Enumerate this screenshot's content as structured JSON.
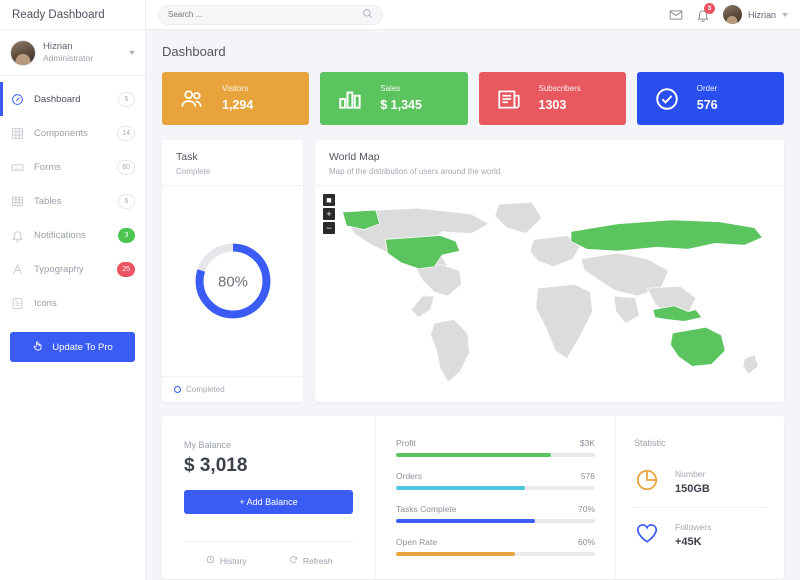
{
  "brand": {
    "title": "Ready Dashboard"
  },
  "user": {
    "name": "Hizrian",
    "role": "Administrator"
  },
  "sidebar": {
    "items": [
      {
        "label": "Dashboard",
        "badge": "5",
        "badge_style": "outline",
        "icon": "gauge-icon",
        "active": true
      },
      {
        "label": "Components",
        "badge": "14",
        "badge_style": "outline",
        "icon": "grid-icon",
        "active": false
      },
      {
        "label": "Forms",
        "badge": "60",
        "badge_style": "outline",
        "icon": "keyboard-icon",
        "active": false
      },
      {
        "label": "Tables",
        "badge": "6",
        "badge_style": "outline",
        "icon": "table-icon",
        "active": false
      },
      {
        "label": "Notifications",
        "badge": "3",
        "badge_style": "green",
        "icon": "bell-icon",
        "active": false
      },
      {
        "label": "Typography",
        "badge": "25",
        "badge_style": "red",
        "icon": "typography-icon",
        "active": false
      },
      {
        "label": "Icons",
        "badge": "",
        "badge_style": "none",
        "icon": "icons-icon",
        "active": false
      }
    ],
    "pro_button": "Update To Pro"
  },
  "topbar": {
    "search_placeholder": "Search ...",
    "search_value": "",
    "notification_count": "3",
    "user_name": "Hizrian"
  },
  "page": {
    "title": "Dashboard"
  },
  "stats": [
    {
      "label": "Visitors",
      "value": "1,294",
      "color": "#e8a33d",
      "icon": "users-icon"
    },
    {
      "label": "Sales",
      "value": "$ 1,345",
      "color": "#5cc45f",
      "icon": "bar-chart-icon"
    },
    {
      "label": "Subscribers",
      "value": "1303",
      "color": "#e8595f",
      "icon": "newspaper-icon"
    },
    {
      "label": "Order",
      "value": "576",
      "color": "#2a4ff0",
      "icon": "check-circle-icon"
    }
  ],
  "task": {
    "title": "Task",
    "subtitle": "Complete",
    "percent_label": "80%",
    "footer": "Completed",
    "accent": "#3a5cf5",
    "track": "#e6e7ea"
  },
  "map": {
    "title": "World Map",
    "subtitle": "Map of the distribution of users around the world",
    "controls": [
      "home-button",
      "zoom-in-button",
      "zoom-out-button"
    ],
    "control_labels": [
      "■",
      "+",
      "−"
    ],
    "highlight_color": "#5cc45f",
    "base_color": "#dcdcdc",
    "highlighted_regions": [
      "United States",
      "Alaska",
      "Russia",
      "Indonesia",
      "Australia"
    ]
  },
  "balance": {
    "label": "My Balance",
    "amount": "$ 3,018",
    "add_button": "+ Add Balance",
    "history": "History",
    "refresh": "Refresh"
  },
  "progress": [
    {
      "label": "Profit",
      "value": "$3K",
      "percent": 78,
      "color": "#5cc45f"
    },
    {
      "label": "Orders",
      "value": "576",
      "percent": 65,
      "color": "#4fc5e8"
    },
    {
      "label": "Tasks Complete",
      "value": "70%",
      "percent": 70,
      "color": "#3a5cf5"
    },
    {
      "label": "Open Rate",
      "value": "60%",
      "percent": 60,
      "color": "#e8a33d"
    }
  ],
  "statistic": {
    "title": "Statistic",
    "items": [
      {
        "label": "Number",
        "value": "150GB",
        "icon": "pie-chart-icon",
        "color": "#e8a33d"
      },
      {
        "label": "Followers",
        "value": "+45K",
        "icon": "heart-icon",
        "color": "#3a5cf5"
      }
    ]
  }
}
